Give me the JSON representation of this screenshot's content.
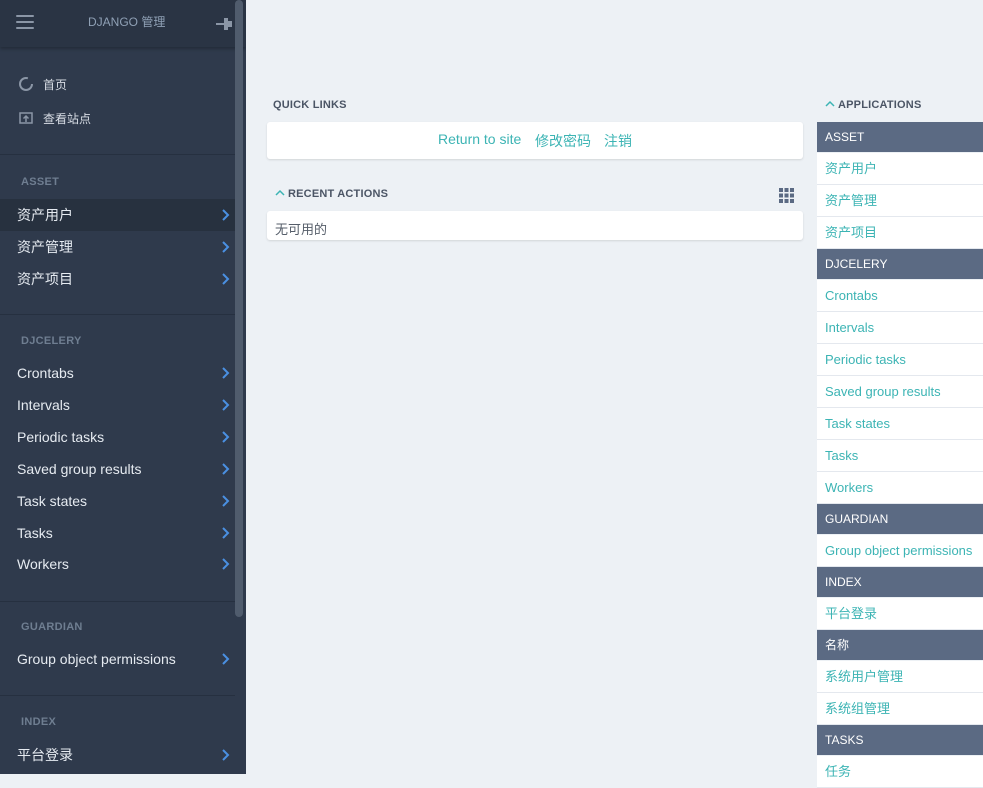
{
  "brand": "DJANGO 管理",
  "sidebar": {
    "quick": [
      {
        "label": "首页",
        "icon": "dashboard-icon"
      },
      {
        "label": "查看站点",
        "icon": "view-site-icon"
      }
    ],
    "sections": [
      {
        "title": "ASSET",
        "items": [
          "资产用户",
          "资产管理",
          "资产项目"
        ]
      },
      {
        "title": "DJCELERY",
        "items": [
          "Crontabs",
          "Intervals",
          "Periodic tasks",
          "Saved group results",
          "Task states",
          "Tasks",
          "Workers"
        ]
      },
      {
        "title": "GUARDIAN",
        "items": [
          "Group object permissions"
        ]
      },
      {
        "title": "INDEX",
        "items": [
          "平台登录"
        ]
      }
    ]
  },
  "quick_links": {
    "title": "QUICK LINKS",
    "links": [
      "Return to site",
      "修改密码",
      "注销"
    ]
  },
  "recent_actions": {
    "title": "RECENT ACTIONS",
    "empty": "无可用的"
  },
  "applications": {
    "title": "APPLICATIONS",
    "groups": [
      {
        "name": "ASSET",
        "items": [
          "资产用户",
          "资产管理",
          "资产项目"
        ]
      },
      {
        "name": "DJCELERY",
        "items": [
          "Crontabs",
          "Intervals",
          "Periodic tasks",
          "Saved group results",
          "Task states",
          "Tasks",
          "Workers"
        ]
      },
      {
        "name": "GUARDIAN",
        "items": [
          "Group object permissions"
        ]
      },
      {
        "name": "INDEX",
        "items": [
          "平台登录"
        ]
      },
      {
        "name": "名称",
        "items": [
          "系统用户管理",
          "系统组管理"
        ]
      },
      {
        "name": "TASKS",
        "items": [
          "任务"
        ]
      }
    ]
  },
  "colors": {
    "sidebar_bg": "#2f3a4c",
    "accent_link": "#3cb4b4",
    "app_header_bg": "#5b6a83",
    "chevron": "#4a90e2"
  }
}
